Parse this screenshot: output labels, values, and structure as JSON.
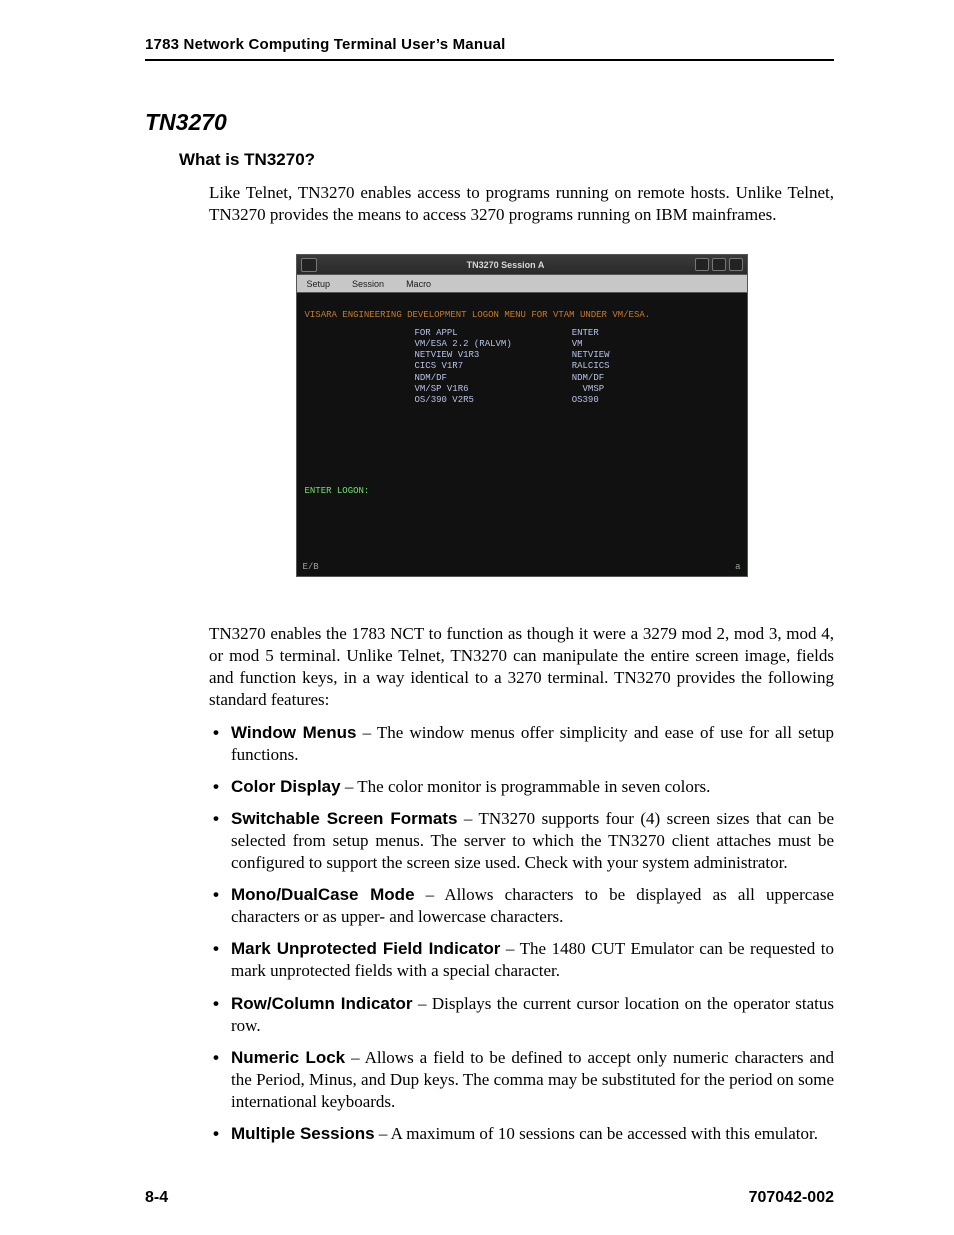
{
  "running_head": "1783 Network Computing Terminal User’s Manual",
  "section_title": "TN3270",
  "subhead": "What is TN3270?",
  "intro": "Like Telnet, TN3270 enables access to programs running on remote hosts. Unlike Telnet, TN3270 provides the means to access 3270 programs running on IBM mainframes.",
  "screenshot": {
    "window_title": "TN3270 Session A",
    "menus": [
      "Setup",
      "Session",
      "Macro"
    ],
    "header_line": "VISARA ENGINEERING DEVELOPMENT LOGON MENU FOR VTAM UNDER VM/ESA.",
    "col_left": "FOR APPL\nVM/ESA 2.2 (RALVM)\nNETVIEW V1R3\nCICS V1R7\nNDM/DF\nVM/SP V1R6\nOS/390 V2R5",
    "col_right": "ENTER\nVM\nNETVIEW\nRALCICS\nNDM/DF\n  VMSP\nOS390",
    "enter_logon": "ENTER LOGON:",
    "status_left": "E/B",
    "status_right": "a"
  },
  "after_fig": "TN3270 enables the 1783 NCT to function as though it were a 3279 mod 2, mod 3, mod 4, or mod 5 terminal. Unlike Telnet, TN3270 can manipulate the entire screen image, fields and function keys, in a way identical to a 3270 terminal. TN3270 provides the following standard features:",
  "features": [
    {
      "name": "Window Menus",
      "text": " – The window menus offer simplicity and ease of use for all setup functions."
    },
    {
      "name": "Color Display",
      "text": " – The color monitor is programmable in seven colors."
    },
    {
      "name": "Switchable Screen Formats",
      "text": " – TN3270 supports four (4) screen sizes that can be selected from setup menus. The server to which the TN3270 client attaches must be configured to support the screen size used. Check with your system administrator."
    },
    {
      "name": "Mono/DualCase Mode",
      "text": " – Allows characters to be displayed as all uppercase characters or as upper- and lowercase characters."
    },
    {
      "name": "Mark Unprotected Field Indicator",
      "text": " – The 1480 CUT Emulator can be requested to mark unprotected fields with a special character."
    },
    {
      "name": "Row/Column Indicator",
      "text": " – Displays the current cursor location on the operator status row."
    },
    {
      "name": "Numeric Lock",
      "text": " – Allows a field to be defined to accept only numeric characters and the Period, Minus, and Dup keys. The comma may be substituted for the period on some international keyboards."
    },
    {
      "name": "Multiple Sessions",
      "text": " – A maximum of 10 sessions can be accessed with this emulator."
    }
  ],
  "footer": {
    "left": "8-4",
    "right": "707042-002"
  }
}
